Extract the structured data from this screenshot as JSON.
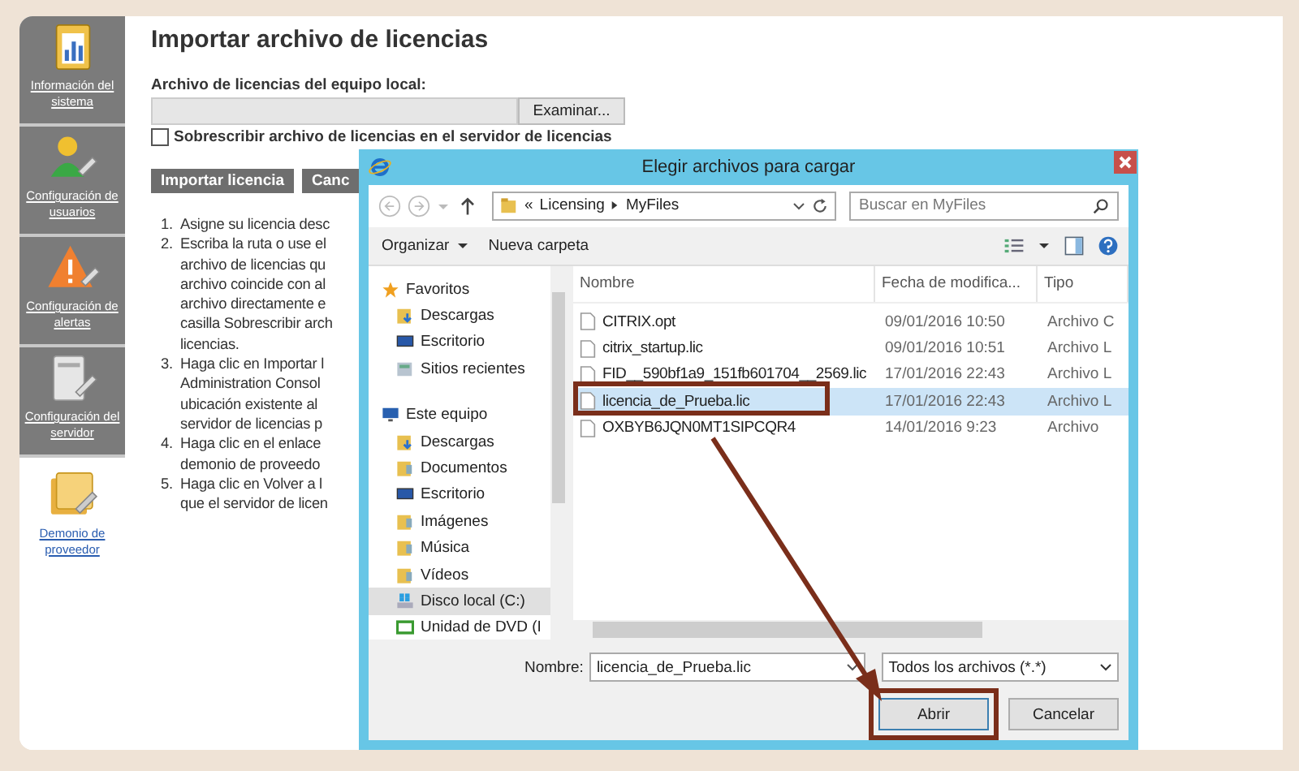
{
  "sidebar": {
    "items": [
      {
        "label": "Información del sistema",
        "selected": false
      },
      {
        "label": "Configuración de usuarios",
        "selected": false
      },
      {
        "label": "Configuración de alertas",
        "selected": false
      },
      {
        "label": "Configuración del servidor",
        "selected": false
      },
      {
        "label": "Demonio de proveedor",
        "selected": true
      }
    ]
  },
  "main": {
    "title": "Importar archivo de licencias",
    "file_label": "Archivo de licencias del equipo local:",
    "browse_button": "Examinar...",
    "overwrite": {
      "label": "Sobrescribir archivo de licencias en el servidor de licencias",
      "checked": false
    },
    "buttons": [
      "Importar licencia",
      "Canc"
    ],
    "instructions": [
      {
        "number": "1.",
        "lines": [
          "Asigne su licencia desc"
        ]
      },
      {
        "number": "2.",
        "lines": [
          "Escriba la ruta o use el",
          "archivo de licencias qu",
          "archivo coincide con al",
          "archivo directamente e",
          "casilla Sobrescribir arch",
          "licencias."
        ]
      },
      {
        "number": "3.",
        "lines": [
          "Haga clic en Importar l",
          "Administration Consol",
          "ubicación existente al",
          "servidor de licencias p"
        ]
      },
      {
        "number": "4.",
        "lines": [
          "Haga clic en el enlace",
          "demonio de proveedo"
        ]
      },
      {
        "number": "5.",
        "lines": [
          "Haga clic en Volver a l",
          "que el servidor de licen"
        ]
      }
    ]
  },
  "dialog": {
    "title": "Elegir archivos para cargar",
    "address_prefix": "«",
    "breadcrumbs": [
      "Licensing",
      "MyFiles"
    ],
    "search": {
      "placeholder": "Buscar en MyFiles"
    },
    "toolbar": [
      "Organizar",
      "Nueva carpeta"
    ],
    "navigation": [
      {
        "label": "Favoritos",
        "kind": "star",
        "selected": false,
        "children": [
          {
            "label": "Descargas",
            "kind": "downloads",
            "selected": false
          },
          {
            "label": "Escritorio",
            "kind": "desktop",
            "selected": false
          },
          {
            "label": "Sitios recientes",
            "kind": "recent",
            "selected": false
          }
        ]
      },
      {
        "label": "Este equipo",
        "kind": "computer",
        "selected": false,
        "children": [
          {
            "label": "Descargas",
            "kind": "downloads",
            "selected": false
          },
          {
            "label": "Documentos",
            "kind": "folder",
            "selected": false
          },
          {
            "label": "Escritorio",
            "kind": "desktop",
            "selected": false
          },
          {
            "label": "Imágenes",
            "kind": "folder",
            "selected": false
          },
          {
            "label": "Música",
            "kind": "folder",
            "selected": false
          },
          {
            "label": "Vídeos",
            "kind": "folder",
            "selected": false
          },
          {
            "label": "Disco local (C:)",
            "kind": "drive",
            "selected": true
          },
          {
            "label": "Unidad de DVD (I",
            "kind": "dvd",
            "selected": false
          }
        ]
      }
    ],
    "columns": [
      "Nombre",
      "Fecha de modifica...",
      "Tipo"
    ],
    "files": [
      {
        "name": "CITRIX.opt",
        "date": "09/01/2016 10:50",
        "type": "Archivo C",
        "selected": false
      },
      {
        "name": "citrix_startup.lic",
        "date": "09/01/2016 10:51",
        "type": "Archivo L",
        "selected": false
      },
      {
        "name": "FID__590bf1a9_151fb601704__2569.lic",
        "date": "17/01/2016 22:43",
        "type": "Archivo L",
        "selected": false
      },
      {
        "name": "licencia_de_Prueba.lic",
        "date": "17/01/2016 22:43",
        "type": "Archivo L",
        "selected": true
      },
      {
        "name": "OXBYB6JQN0MT1SIPCQR4",
        "date": "14/01/2016 9:23",
        "type": "Archivo",
        "selected": false
      }
    ],
    "filename": {
      "label": "Nombre:",
      "value": "licencia_de_Prueba.lic"
    },
    "filetype": "Todos los archivos (*.*)",
    "buttons": [
      "Abrir",
      "Cancelar"
    ]
  }
}
